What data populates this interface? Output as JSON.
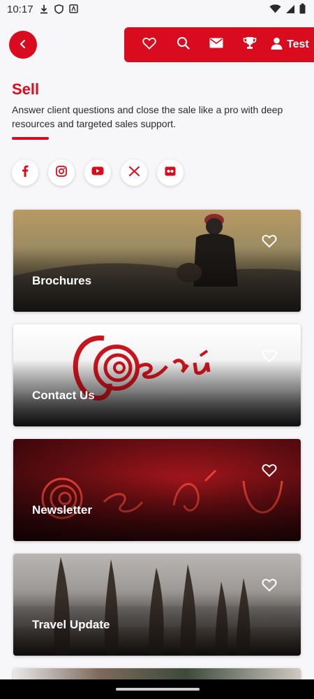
{
  "status_bar": {
    "time": "10:17"
  },
  "header": {
    "profile_label": "Test"
  },
  "page": {
    "title": "Sell",
    "description": "Answer client questions and close the sale like a pro with deep resources and targeted sales support."
  },
  "social": [
    {
      "icon": "facebook-icon"
    },
    {
      "icon": "instagram-icon"
    },
    {
      "icon": "youtube-icon"
    },
    {
      "icon": "x-icon"
    },
    {
      "icon": "flickr-icon"
    }
  ],
  "cards": [
    {
      "label": "Brochures"
    },
    {
      "label": "Contact Us"
    },
    {
      "label": "Newsletter"
    },
    {
      "label": "Travel Update"
    }
  ],
  "colors": {
    "accent": "#d90b1e",
    "background": "#f7f7fa"
  }
}
